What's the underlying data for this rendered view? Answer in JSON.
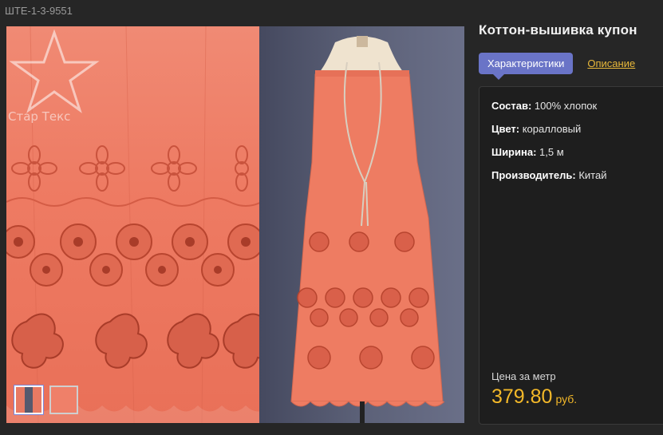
{
  "sku": "ШТЕ-1-3-9551",
  "gallery": {
    "watermark_logo": "STAR tex",
    "watermark_text": "Стар Текс"
  },
  "product": {
    "title": "Коттон-вышивка купон"
  },
  "tabs": {
    "active": "Характеристики",
    "other": "Описание"
  },
  "specs": [
    {
      "label": "Состав:",
      "value": " 100% хлопок"
    },
    {
      "label": "Цвет:",
      "value": " коралловый"
    },
    {
      "label": "Ширина:",
      "value": " 1,5 м"
    },
    {
      "label": "Производитель:",
      "value": " Китай"
    }
  ],
  "price": {
    "label": "Цена за метр",
    "value": "379.80",
    "unit": "руб."
  },
  "colors": {
    "accent": "#6a74c7",
    "price": "#f3b829",
    "fabric": "#ee7b63"
  }
}
